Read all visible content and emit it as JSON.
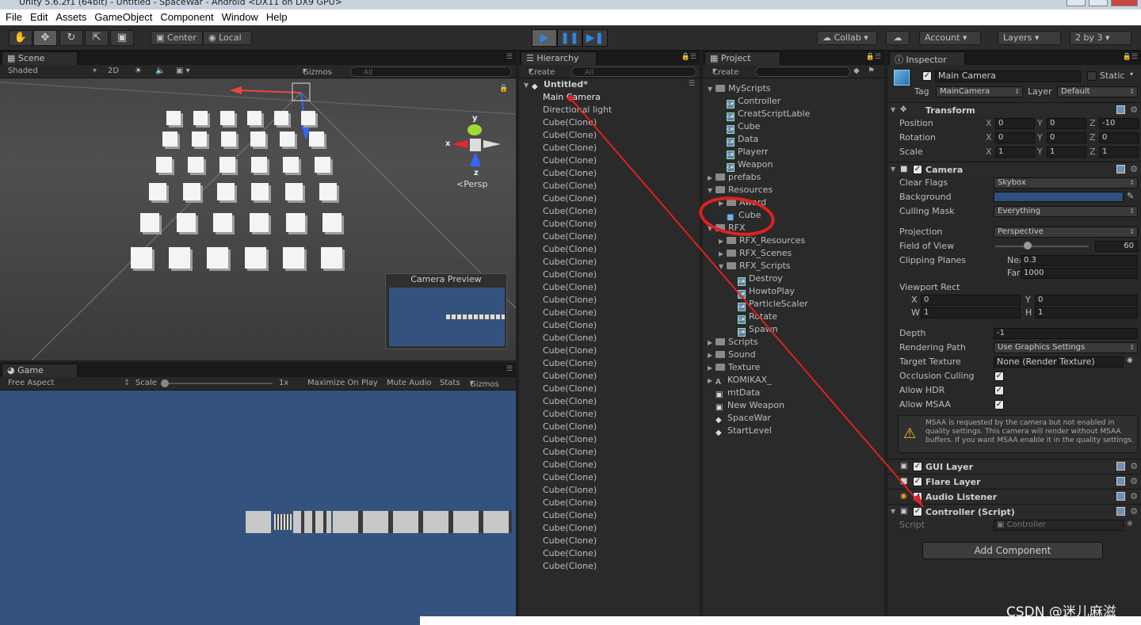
{
  "window": {
    "title": "Unity 5.6.2f1 (64bit) - Untitled - SpaceWar - Android <DX11 on DX9 GPU>"
  },
  "menu": [
    "File",
    "Edit",
    "Assets",
    "GameObject",
    "Component",
    "Window",
    "Help"
  ],
  "toolbar": {
    "center_label": "Center",
    "local_label": "Local",
    "collab_label": "Collab",
    "account_label": "Account",
    "layers_label": "Layers",
    "layout_label": "2 by 3"
  },
  "scene": {
    "tab": "Scene",
    "shading": "Shaded",
    "mode_2d": "2D",
    "gizmos": "Gizmos",
    "search_placeholder": "All",
    "persp_label": "Persp",
    "axis_x": "x",
    "axis_y": "y",
    "axis_z": "z",
    "camera_preview_title": "Camera Preview"
  },
  "game": {
    "tab": "Game",
    "aspect": "Free Aspect",
    "scale_label": "Scale",
    "scale_value": "1x",
    "maximize": "Maximize On Play",
    "mute": "Mute Audio",
    "stats": "Stats",
    "gizmos": "Gizmos",
    "bg_color": "#33527e"
  },
  "hierarchy": {
    "tab": "Hierarchy",
    "create": "Create",
    "search_placeholder": "All",
    "scene_name": "Untitled*",
    "items": [
      "Main Camera",
      "Directional light",
      "Cube(Clone)",
      "Cube(Clone)",
      "Cube(Clone)",
      "Cube(Clone)",
      "Cube(Clone)",
      "Cube(Clone)",
      "Cube(Clone)",
      "Cube(Clone)",
      "Cube(Clone)",
      "Cube(Clone)",
      "Cube(Clone)",
      "Cube(Clone)",
      "Cube(Clone)",
      "Cube(Clone)",
      "Cube(Clone)",
      "Cube(Clone)",
      "Cube(Clone)",
      "Cube(Clone)",
      "Cube(Clone)",
      "Cube(Clone)",
      "Cube(Clone)",
      "Cube(Clone)",
      "Cube(Clone)",
      "Cube(Clone)",
      "Cube(Clone)",
      "Cube(Clone)",
      "Cube(Clone)",
      "Cube(Clone)",
      "Cube(Clone)",
      "Cube(Clone)",
      "Cube(Clone)",
      "Cube(Clone)",
      "Cube(Clone)",
      "Cube(Clone)",
      "Cube(Clone)",
      "Cube(Clone)"
    ]
  },
  "project": {
    "tab": "Project",
    "create": "Create",
    "items": [
      {
        "label": "MyScripts",
        "kind": "folder",
        "depth": 0,
        "open": true
      },
      {
        "label": "Controller",
        "kind": "script",
        "depth": 1
      },
      {
        "label": "CreatScriptLable",
        "kind": "script",
        "depth": 1
      },
      {
        "label": "Cube",
        "kind": "script",
        "depth": 1
      },
      {
        "label": "Data",
        "kind": "script",
        "depth": 1
      },
      {
        "label": "Playerr",
        "kind": "script",
        "depth": 1
      },
      {
        "label": "Weapon",
        "kind": "script",
        "depth": 1
      },
      {
        "label": "prefabs",
        "kind": "folder",
        "depth": 0,
        "open": false
      },
      {
        "label": "Resources",
        "kind": "folder",
        "depth": 0,
        "open": true
      },
      {
        "label": "Award",
        "kind": "folder",
        "depth": 1,
        "open": false
      },
      {
        "label": "Cube",
        "kind": "prefab",
        "depth": 1
      },
      {
        "label": "RFX",
        "kind": "folder",
        "depth": 0,
        "open": true
      },
      {
        "label": "RFX_Resources",
        "kind": "folder",
        "depth": 1,
        "open": false
      },
      {
        "label": "RFX_Scenes",
        "kind": "folder",
        "depth": 1,
        "open": false
      },
      {
        "label": "RFX_Scripts",
        "kind": "folder",
        "depth": 1,
        "open": true
      },
      {
        "label": "Destroy",
        "kind": "script",
        "depth": 2
      },
      {
        "label": "HowtoPlay",
        "kind": "script",
        "depth": 2
      },
      {
        "label": "ParticleScaler",
        "kind": "script",
        "depth": 2
      },
      {
        "label": "Rotate",
        "kind": "script",
        "depth": 2
      },
      {
        "label": "Spawn",
        "kind": "script",
        "depth": 2
      },
      {
        "label": "Scripts",
        "kind": "folder",
        "depth": 0,
        "open": false
      },
      {
        "label": "Sound",
        "kind": "folder",
        "depth": 0,
        "open": false
      },
      {
        "label": "Texture",
        "kind": "folder",
        "depth": 0,
        "open": false
      },
      {
        "label": "KOMIKAX_",
        "kind": "font",
        "depth": 0,
        "open": false
      },
      {
        "label": "mtData",
        "kind": "asset",
        "depth": 0
      },
      {
        "label": "New Weapon",
        "kind": "asset",
        "depth": 0
      },
      {
        "label": "SpaceWar",
        "kind": "unity",
        "depth": 0
      },
      {
        "label": "StartLevel",
        "kind": "unity",
        "depth": 0
      }
    ]
  },
  "inspector": {
    "tab": "Inspector",
    "object_name": "Main Camera",
    "static_label": "Static",
    "tag_label": "Tag",
    "tag_value": "MainCamera",
    "layer_label": "Layer",
    "layer_value": "Default",
    "transform": {
      "title": "Transform",
      "position_label": "Position",
      "rotation_label": "Rotation",
      "scale_label": "Scale",
      "position": [
        "0",
        "0",
        "-10"
      ],
      "rotation": [
        "0",
        "0",
        "0"
      ],
      "scale": [
        "1",
        "1",
        "1"
      ]
    },
    "camera": {
      "title": "Camera",
      "clear_flags_label": "Clear Flags",
      "clear_flags": "Skybox",
      "background_label": "Background",
      "background_color": "#30507d",
      "culling_mask_label": "Culling Mask",
      "culling_mask": "Everything",
      "projection_label": "Projection",
      "projection": "Perspective",
      "fov_label": "Field of View",
      "fov": "60",
      "clipping_label": "Clipping Planes",
      "near_label": "Near",
      "near": "0.3",
      "far_label": "Far",
      "far": "1000",
      "viewport_label": "Viewport Rect",
      "vx": "0",
      "vy": "0",
      "vw": "1",
      "vh": "1",
      "depth_label": "Depth",
      "depth": "-1",
      "rendering_path_label": "Rendering Path",
      "rendering_path": "Use Graphics Settings",
      "target_texture_label": "Target Texture",
      "target_texture": "None (Render Texture)",
      "occlusion_label": "Occlusion Culling",
      "hdr_label": "Allow HDR",
      "msaa_label": "Allow MSAA",
      "msaa_warning": "MSAA is requested by the camera but not enabled in quality settings. This camera will render without MSAA buffers. If you want MSAA enable it in the quality settings."
    },
    "gui_layer": "GUI Layer",
    "flare_layer": "Flare Layer",
    "audio_listener": "Audio Listener",
    "controller": {
      "title": "Controller (Script)",
      "script_label": "Script",
      "script_value": "Controller"
    },
    "add_component": "Add Component"
  },
  "watermark": "CSDN @迷儿麻滋"
}
